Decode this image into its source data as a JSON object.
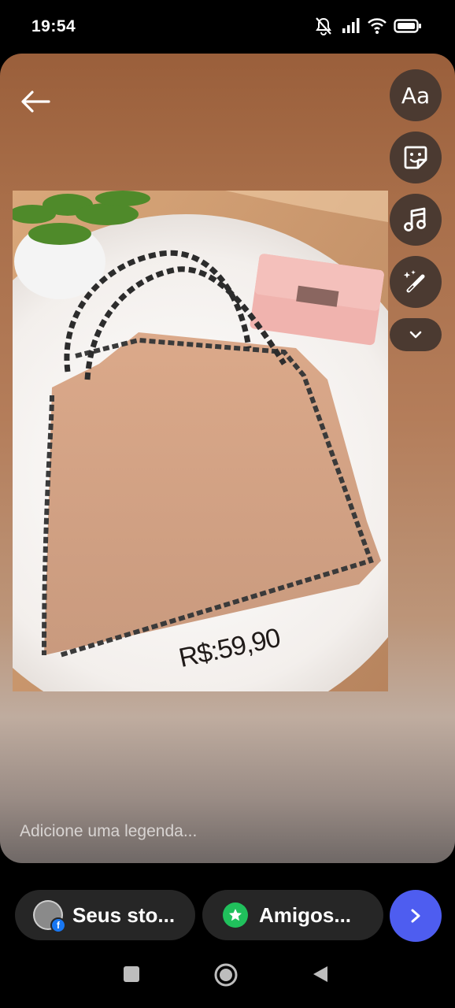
{
  "status_bar": {
    "time": "19:54",
    "icons": [
      "notifications-off-icon",
      "signal-icon",
      "wifi-icon",
      "battery-icon"
    ]
  },
  "story_editor": {
    "photo_price_text": "R$:59,90",
    "caption_placeholder": "Adicione uma legenda...",
    "tools": [
      {
        "name": "text-tool",
        "label": "Aa"
      },
      {
        "name": "sticker-tool",
        "icon": "sticker-icon"
      },
      {
        "name": "music-tool",
        "icon": "music-note-icon"
      },
      {
        "name": "effects-tool",
        "icon": "magic-wand-icon"
      },
      {
        "name": "more-tools",
        "icon": "chevron-down-icon"
      }
    ]
  },
  "share_bar": {
    "your_stories_label": "Seus sto...",
    "close_friends_label": "Amigos...",
    "send_icon": "chevron-right-icon"
  },
  "colors": {
    "pill_bg": "#262626",
    "send_button": "#4e5df0",
    "close_friends_green": "#20c05c",
    "tool_bg": "#4b3a31"
  }
}
